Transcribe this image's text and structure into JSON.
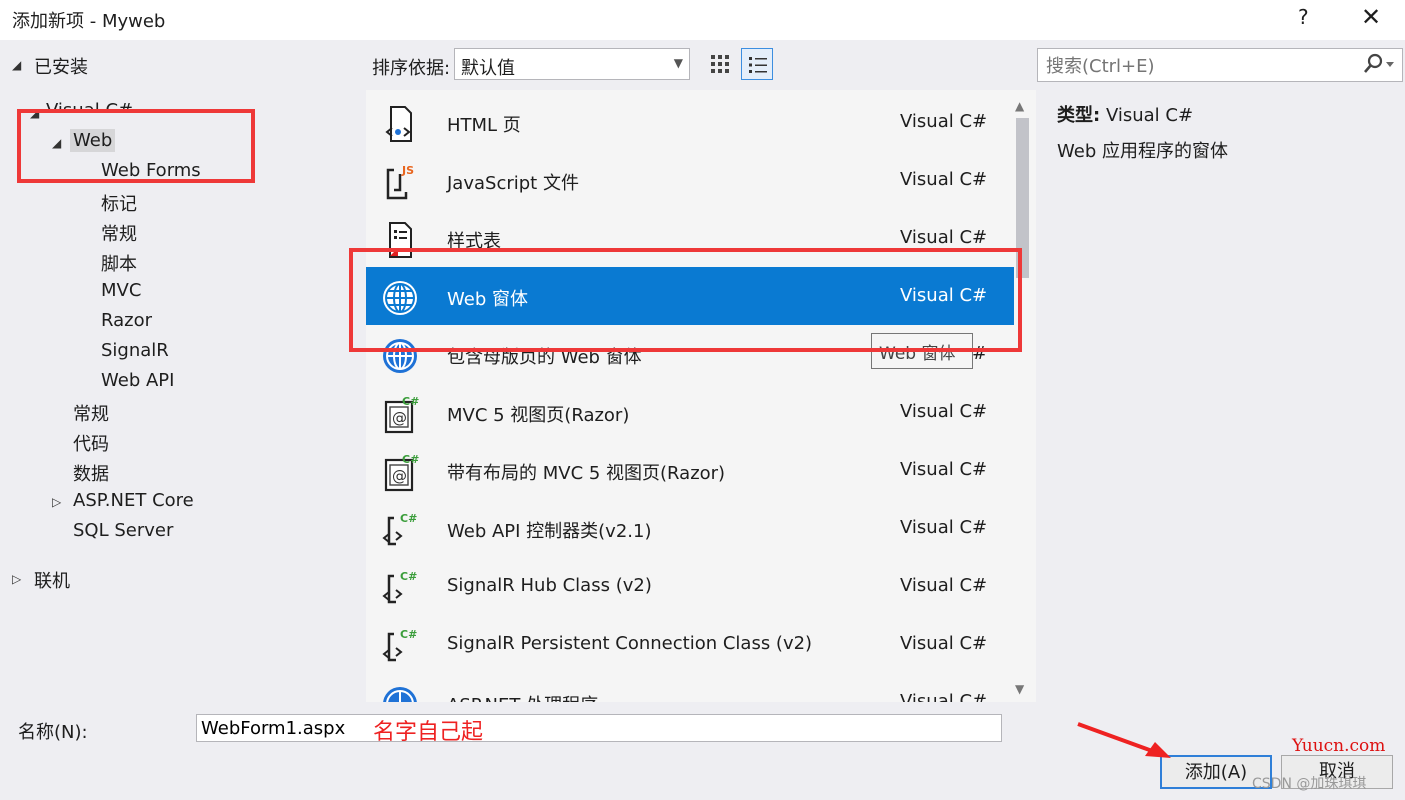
{
  "window": {
    "title": "添加新项 - Myweb",
    "help": "?",
    "close": "✕"
  },
  "tree": {
    "installed": "已安装",
    "visual_csharp": "Visual C#",
    "web": "Web",
    "web_children": [
      "Web Forms",
      "标记",
      "常规",
      "脚本",
      "MVC",
      "Razor",
      "SignalR",
      "Web API"
    ],
    "csharp_children": [
      "常规",
      "代码",
      "数据",
      "ASP.NET Core",
      "SQL Server"
    ],
    "online": "联机"
  },
  "toolbar": {
    "sort_label": "排序依据:",
    "sort_value": "默认值",
    "search_placeholder": "搜索(Ctrl+E)"
  },
  "templates": [
    {
      "name": "HTML 页",
      "type": "Visual C#",
      "icon": "html-page-icon"
    },
    {
      "name": "JavaScript 文件",
      "type": "Visual C#",
      "icon": "javascript-file-icon"
    },
    {
      "name": "样式表",
      "type": "Visual C#",
      "icon": "stylesheet-icon"
    },
    {
      "name": "Web 窗体",
      "type": "Visual C#",
      "icon": "globe-icon",
      "selected": true
    },
    {
      "name": "包含母版页的 Web 窗体",
      "type": "Visual C#",
      "icon": "globe-icon"
    },
    {
      "name": "MVC 5 视图页(Razor)",
      "type": "Visual C#",
      "icon": "razor-view-icon"
    },
    {
      "name": "带有布局的 MVC 5 视图页(Razor)",
      "type": "Visual C#",
      "icon": "razor-view-icon"
    },
    {
      "name": "Web API 控制器类(v2.1)",
      "type": "Visual C#",
      "icon": "csharp-class-icon"
    },
    {
      "name": "SignalR Hub Class (v2)",
      "type": "Visual C#",
      "icon": "csharp-class-icon"
    },
    {
      "name": "SignalR Persistent Connection Class (v2)",
      "type": "Visual C#",
      "icon": "csharp-class-icon"
    },
    {
      "name": "ASP.NET 处理程序",
      "type": "Visual C#",
      "icon": "globe-icon"
    }
  ],
  "tooltip": "Web 窗体",
  "info": {
    "type_label": "类型:",
    "type_value": "Visual C#",
    "description": "Web 应用程序的窗体"
  },
  "footer": {
    "name_label": "名称(N):",
    "name_value": "WebForm1.aspx",
    "annotation": "名字自己起",
    "add_button": "添加(A)",
    "cancel_button": "取消"
  },
  "watermarks": {
    "yuucn": "Yuucn.com",
    "csdn": "CSDN @加珠琪琪"
  },
  "colors": {
    "selection": "#0a7ad2",
    "annotation_red": "#ee3838",
    "icon_blue": "#1f72d6"
  }
}
